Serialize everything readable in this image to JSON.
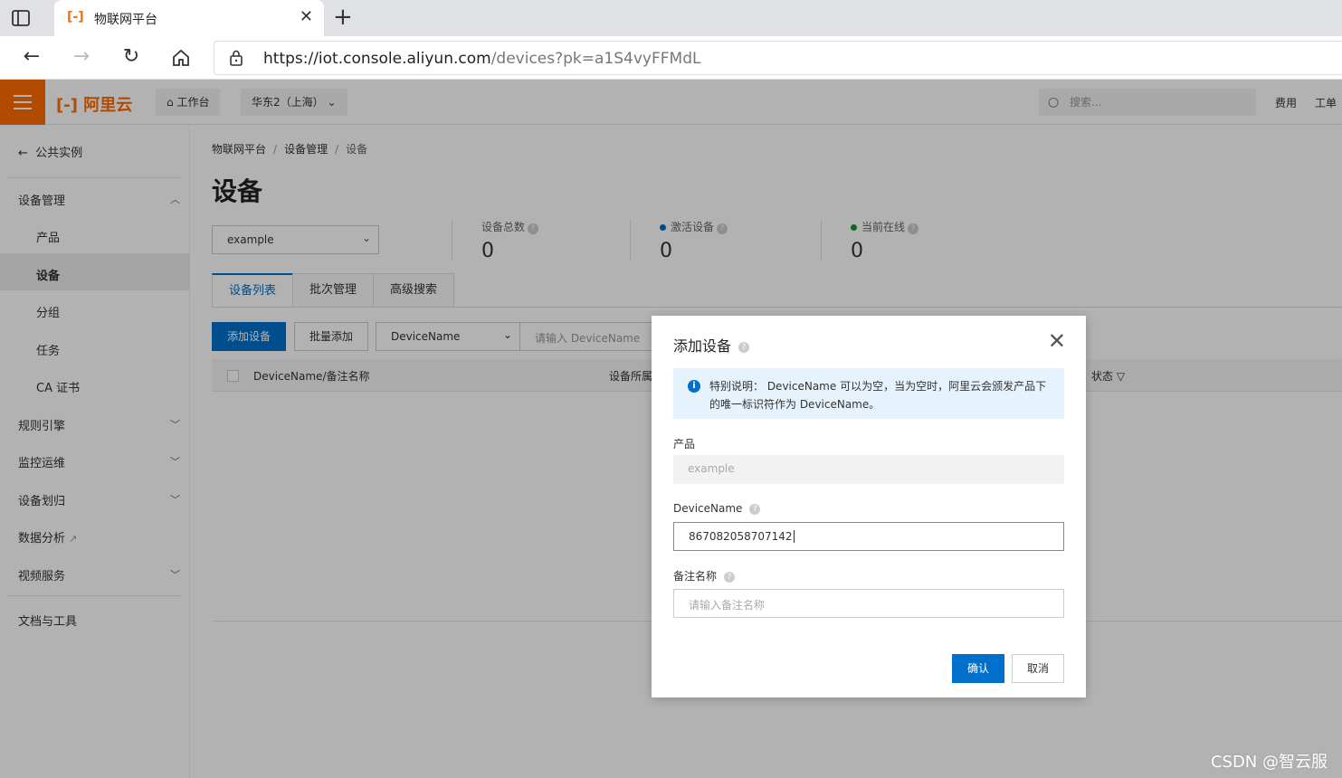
{
  "browser": {
    "tab_title": "物联网平台",
    "url_host": "https://iot.console.aliyun.com",
    "url_path": "/devices?pk=a1S4vyFFMdL"
  },
  "console": {
    "logo": "阿里云",
    "workbench": "工作台",
    "region": "华东2（上海）",
    "search_placeholder": "搜索...",
    "link_fees": "费用",
    "link_tickets": "工单"
  },
  "sidebar": {
    "back": "公共实例",
    "group_device_mgmt": "设备管理",
    "sub_items": [
      "产品",
      "设备",
      "分组",
      "任务",
      "CA 证书"
    ],
    "items": [
      "规则引擎",
      "监控运维",
      "设备划归",
      "数据分析",
      "视频服务"
    ],
    "docs": "文档与工具"
  },
  "main": {
    "breadcrumb": [
      "物联网平台",
      "设备管理",
      "设备"
    ],
    "title": "设备",
    "product_select": "example",
    "stats": [
      {
        "label": "设备总数",
        "value": "0",
        "color": ""
      },
      {
        "label": "激活设备",
        "value": "0",
        "color": "#0070cc"
      },
      {
        "label": "当前在线",
        "value": "0",
        "color": "#1e8e3e"
      }
    ],
    "tabs": [
      "设备列表",
      "批次管理",
      "高级搜索"
    ],
    "add_device_btn": "添加设备",
    "batch_add_btn": "批量添加",
    "filter_select": "DeviceName",
    "filter_placeholder": "请输入 DeviceName",
    "col_name": "DeviceName/备注名称",
    "col_product": "设备所属",
    "col_status": "状态"
  },
  "dialog": {
    "title": "添加设备",
    "notice": "特别说明： DeviceName 可以为空，当为空时，阿里云会颁发产品下的唯一标识符作为 DeviceName。",
    "product_label": "产品",
    "product_value": "example",
    "devicename_label": "DeviceName",
    "devicename_value": "867082058707142",
    "remark_label": "备注名称",
    "remark_placeholder": "请输入备注名称",
    "confirm": "确认",
    "cancel": "取消"
  },
  "watermark": "CSDN @智云服"
}
